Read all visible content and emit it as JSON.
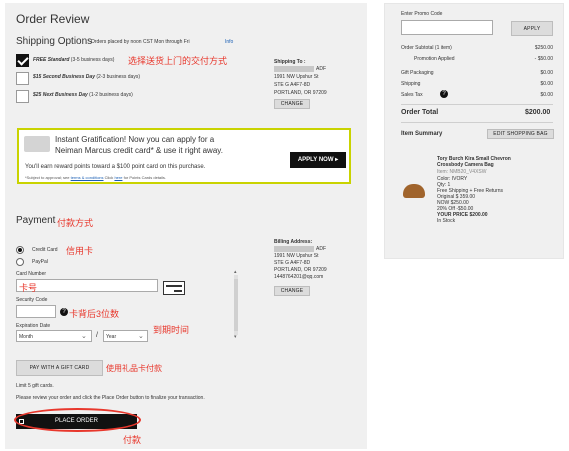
{
  "order_review": {
    "title": "Order Review",
    "shipping": {
      "heading": "Shipping Options",
      "note": "Orders placed by noon CST Mon through Fri",
      "info_link": "Info",
      "annotation": "选择送货上门的交付方式",
      "options": [
        {
          "name": "FREE Standard",
          "detail": "(3-5 business days)",
          "checked": true
        },
        {
          "name": "$15 Second Business Day",
          "detail": "(2-3 business days)",
          "checked": false
        },
        {
          "name": "$25 Next Business Day",
          "detail": "(1-2 business days)",
          "checked": false
        }
      ],
      "ship_to": {
        "label": "Shipping To :",
        "name_suffix": "ADF",
        "lines": [
          "1991 NW Upshur St",
          "STE G A4F7-8D",
          "PORTLAND, OR 97209"
        ],
        "change_label": "CHANGE"
      }
    },
    "promo_banner": {
      "line1": "Instant Gratification! Now you can apply for a",
      "line2": "Neiman Marcus credit card* & use it right away.",
      "line3": "You'll earn reward points toward a $100 point card on this purchase.",
      "fineprint_prefix": "*Subject to approval; see",
      "terms_link": "terms & conditions",
      "fineprint_mid": "Click",
      "here_link": "here",
      "fineprint_suffix": "for Points Cards details.",
      "apply_label": "APPLY NOW ▸"
    },
    "payment": {
      "heading": "Payment",
      "annotation": "付款方式",
      "methods": [
        {
          "label": "Credit Card",
          "annotation": "信用卡",
          "selected": true
        },
        {
          "label": "PayPal",
          "annotation": "",
          "selected": false
        }
      ],
      "card_number_label": "Card Number",
      "card_number_annotation": "卡号",
      "security_code_label": "Security Code",
      "security_code_annotation": "卡背后3位数",
      "expiration_label": "Expiration Date",
      "expiration_annotation": "到期时间",
      "month_value": "Month",
      "year_value": "Year",
      "slash": "/",
      "help_glyph": "?",
      "billing": {
        "label": "Billing Address:",
        "name_suffix": "ADF",
        "lines": [
          "1991 NW Upshur St",
          "STE G A4F7-8D",
          "PORTLAND, OR 97209",
          "1448764201@qq.com"
        ],
        "change_label": "CHANGE"
      },
      "gift_card_label": "PAY WITH A GIFT CARD",
      "gift_card_annotation": "使用礼品卡付款",
      "gift_limit": "Limit 5 gift cards.",
      "review_note": "Please review your order and click the Place Order button to finalize your transaction.",
      "place_order_label": "PLACE ORDER",
      "place_order_annotation": "付款"
    }
  },
  "summary": {
    "promo_label": "Enter Promo Code",
    "promo_placeholder": "",
    "apply_label": "APPLY",
    "rows": [
      {
        "label": "Order Subtotal (1 item)",
        "value": "$250.00"
      },
      {
        "label": "Promotion Applied",
        "value": "- $50.00"
      },
      {
        "label": "Gift Packaging",
        "value": "$0.00"
      },
      {
        "label": "Shipping",
        "value": "$0.00"
      },
      {
        "label": "Sales Tax",
        "value": "$0.00"
      }
    ],
    "total_label": "Order Total",
    "total_value": "$200.00",
    "item_summary_label": "Item Summary",
    "edit_bag_label": "EDIT SHOPPING BAG",
    "product": {
      "name_line1": "Tory Burch Kira Small Chevron",
      "name_line2": "Crossbody Camera Bag",
      "details": [
        "Item: NMB20_V4XSW",
        "Color: IVORY",
        "Qty: 1",
        "Free Shipping + Free Returns",
        "Original $ 359.00",
        "NOW $250.00",
        "20% Off -$50.00",
        "YOUR PRICE $200.00",
        "In Stock"
      ]
    }
  },
  "colors": {
    "accent_red": "#e8372c",
    "banner_border": "#c9d300",
    "link_blue": "#1a5fb4"
  }
}
